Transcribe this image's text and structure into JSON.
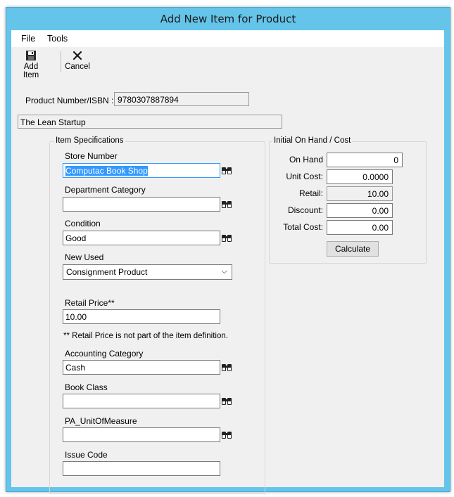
{
  "window": {
    "title": "Add New Item for Product"
  },
  "menu": {
    "file": "File",
    "tools": "Tools"
  },
  "toolbar": {
    "add_item": "Add Item",
    "cancel": "Cancel"
  },
  "product": {
    "label": "Product Number/ISBN :",
    "isbn": "9780307887894",
    "title": "The Lean Startup"
  },
  "item_specs": {
    "group_title": "Item Specifications",
    "store_number_label": "Store Number",
    "store_number_value": "Computac Book Shop",
    "department_label": "Department Category",
    "department_value": "",
    "condition_label": "Condition",
    "condition_value": "Good",
    "new_used_label": "New Used",
    "new_used_value": "Consignment Product",
    "retail_price_label": "Retail Price**",
    "retail_price_value": "10.00",
    "retail_note": "** Retail Price is not part of the item definition.",
    "accounting_label": "Accounting Category",
    "accounting_value": "Cash",
    "book_class_label": "Book Class",
    "book_class_value": "",
    "uom_label": "PA_UnitOfMeasure",
    "uom_value": "",
    "issue_code_label": "Issue Code",
    "issue_code_value": ""
  },
  "onhand": {
    "group_title": "Initial On Hand / Cost",
    "on_hand_label": "On Hand",
    "on_hand_value": "0",
    "unit_cost_label": "Unit Cost:",
    "unit_cost_value": "0.0000",
    "retail_label": "Retail:",
    "retail_value": "10.00",
    "discount_label": "Discount:",
    "discount_value": "0.00",
    "total_cost_label": "Total Cost:",
    "total_cost_value": "0.00",
    "calculate": "Calculate"
  }
}
